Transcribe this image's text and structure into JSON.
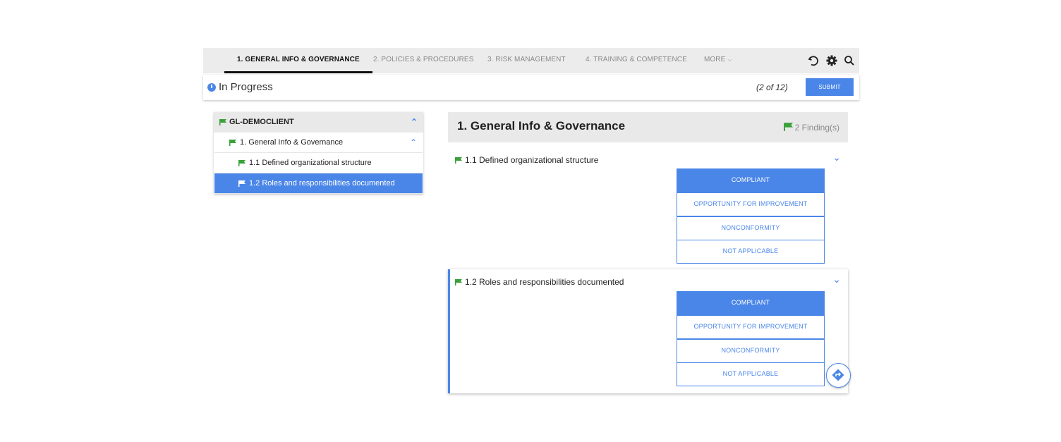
{
  "nav": {
    "tabs": [
      {
        "label": "1. GENERAL INFO & GOVERNANCE",
        "active": true
      },
      {
        "label": "2. POLICIES & PROCEDURES",
        "active": false
      },
      {
        "label": "3. RISK MANAGEMENT",
        "active": false
      },
      {
        "label": "4. TRAINING & COMPETENCE",
        "active": false
      },
      {
        "label": "MORE",
        "active": false
      }
    ],
    "icons": [
      "undo-icon",
      "gear-icon",
      "search-icon"
    ]
  },
  "status": {
    "text": "In Progress",
    "pager": "(2 of 12)",
    "submit_label": "SUBMIT"
  },
  "sidebar": {
    "root": {
      "label": "GL-DEMOCLIENT"
    },
    "section": {
      "label": "1. General Info & Governance"
    },
    "items": [
      {
        "label": "1.1 Defined organizational structure",
        "selected": false
      },
      {
        "label": "1.2 Roles and responsibilities documented",
        "selected": true
      }
    ]
  },
  "main": {
    "title": "1. General Info & Governance",
    "findings": "2 Finding(s)",
    "questions": [
      {
        "title": "1.1 Defined organizational structure",
        "options": [
          "COMPLIANT",
          "OPPORTUNITY FOR IMPROVEMENT",
          "NONCONFORMITY",
          "NOT APPLICABLE"
        ],
        "selected": "COMPLIANT"
      },
      {
        "title": "1.2 Roles and responsibilities documented",
        "options": [
          "COMPLIANT",
          "OPPORTUNITY FOR IMPROVEMENT",
          "NONCONFORMITY",
          "NOT APPLICABLE"
        ],
        "selected": "COMPLIANT"
      }
    ]
  },
  "colors": {
    "accent": "#4a86e8",
    "flag": "#3aa13a",
    "nav_bg": "#ececec",
    "muted": "#8a8a8a"
  }
}
